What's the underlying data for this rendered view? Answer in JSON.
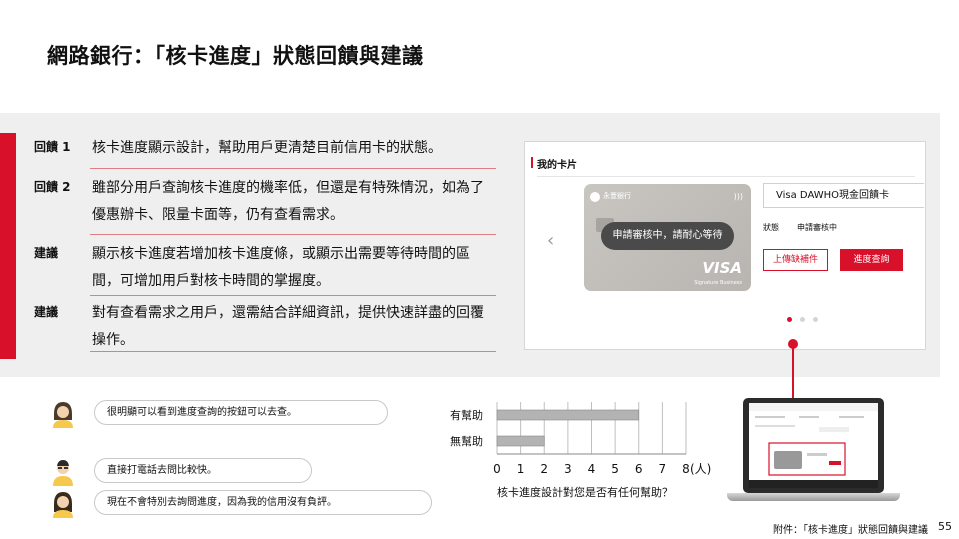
{
  "title": "網路銀行：「核卡進度」狀態回饋與建議",
  "feedback": [
    {
      "label": "回饋 1",
      "text": "核卡進度顯示設計，幫助用戶更清楚目前信用卡的狀態。"
    },
    {
      "label": "回饋 2",
      "text": "雖部分用戶查詢核卡進度的機率低，但還是有特殊情況，如為了優惠辦卡、限量卡面等，仍有查看需求。"
    },
    {
      "label": "建議",
      "text": "顯示核卡進度若增加核卡進度條，或顯示出需要等待時間的區間，可增加用戶對核卡時間的掌握度。"
    },
    {
      "label": "建議",
      "text": "對有查看需求之用戶，還需結合詳細資訊，提供快速詳盡的回覆操作。"
    }
  ],
  "card_ui": {
    "heading": "我的卡片",
    "bank_name": "永豐銀行",
    "status_pill": "申請審核中，請耐心等待",
    "card_brand": "VISA",
    "card_brand_sub": "Signature Business",
    "card_name": "Visa DAWHO現金回饋卡",
    "status_label": "狀態",
    "status_value": "申請審核中",
    "upload_button": "上傳缺補件",
    "progress_button": "進度查詢",
    "accent": "#d8102a"
  },
  "quotes": [
    "很明顯可以看到進度查詢的按鈕可以去查。",
    "直接打電話去問比較快。",
    "現在不會特別去詢問進度，因為我的信用沒有負評。"
  ],
  "chart_data": {
    "type": "bar",
    "orientation": "horizontal",
    "categories": [
      "有幫助",
      "無幫助"
    ],
    "values": [
      6,
      2
    ],
    "xlim": [
      0,
      8
    ],
    "x_ticks": [
      "0",
      "1",
      "2",
      "3",
      "4",
      "5",
      "6",
      "7",
      "8"
    ],
    "unit_label": "(人)",
    "question": "核卡進度設計對您是否有任何幫助？",
    "bar_color": "#b3b3b3"
  },
  "footer": "附件：「核卡進度」狀態回饋與建議",
  "page_number": "55"
}
